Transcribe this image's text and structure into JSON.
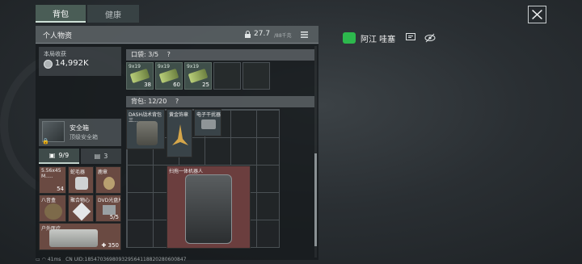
{
  "tabs": {
    "backpack": "背包",
    "health": "健康"
  },
  "inventory": {
    "title": "个人物资",
    "weight": "27.7",
    "weight_cap": "/88千克"
  },
  "earnings": {
    "label": "本局收获",
    "value": "14,992K"
  },
  "safe": {
    "name": "安全箱",
    "sub": "顶级安全箱",
    "lock": "🔒"
  },
  "subtabs": {
    "a": "9/9",
    "b": "3"
  },
  "pocket": {
    "label": "口袋: 3/5",
    "help": "?",
    "items": [
      {
        "name": "9x19",
        "count": "38"
      },
      {
        "name": "9x19",
        "count": "60"
      },
      {
        "name": "9x19",
        "count": "25"
      }
    ]
  },
  "backpack": {
    "label": "背包: 12/20",
    "help": "?",
    "items": [
      {
        "name": "DASH战术背包",
        "extra": "三..."
      },
      {
        "name": "黄金饰章"
      },
      {
        "name": "电子干扰器"
      },
      {
        "name": "扫拖一体机器人"
      }
    ]
  },
  "safe_items": [
    {
      "name": "5.56x45",
      "sub": "M.....",
      "count": "54"
    },
    {
      "name": "蛇毛器"
    },
    {
      "name": "鹿章"
    },
    {
      "name": "八音盒"
    },
    {
      "name": "聚合物心"
    },
    {
      "name": "DVD光盘片",
      "count": "5/5"
    },
    {
      "name": "户外医疗",
      "count": "350"
    }
  ],
  "player": {
    "name": "阿江 哇塞"
  },
  "status": {
    "ping": "41ms",
    "uid": "CN UID:185470369809329564118820280600847"
  },
  "colors": {
    "wechat": "#2db84d",
    "item_red": "#6a4a42",
    "item_green": "#3f4f4a"
  }
}
